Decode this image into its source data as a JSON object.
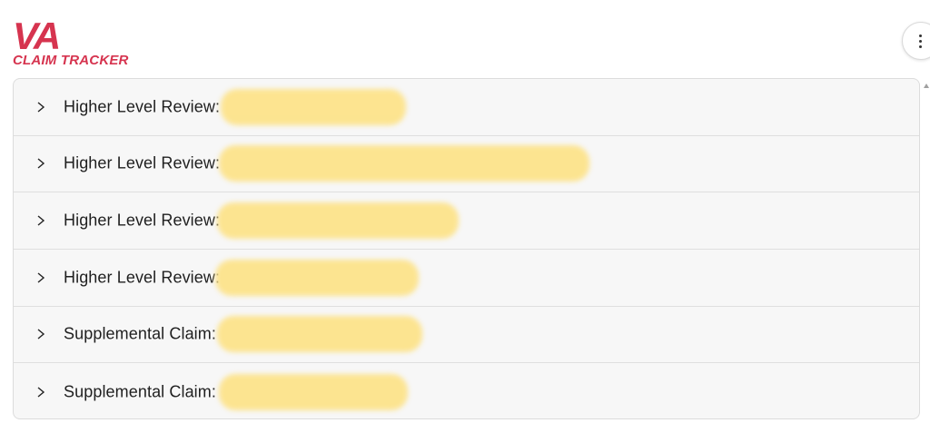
{
  "logo": {
    "line1": "VA",
    "line2": "CLAIM TRACKER",
    "color": "#d6344f"
  },
  "menu": {
    "icon": "more-vertical-icon"
  },
  "claims": [
    {
      "label": "Higher Level Review:",
      "expand_icon": "chevron-right-icon",
      "redacted": true
    },
    {
      "label": "Higher Level Review:",
      "expand_icon": "chevron-right-icon",
      "redacted": true
    },
    {
      "label": "Higher Level Review:",
      "expand_icon": "chevron-right-icon",
      "redacted": true
    },
    {
      "label": "Higher Level Review:",
      "expand_icon": "chevron-right-icon",
      "redacted": true
    },
    {
      "label": "Supplemental Claim:",
      "expand_icon": "chevron-right-icon",
      "redacted": true
    },
    {
      "label": "Supplemental Claim:",
      "expand_icon": "chevron-right-icon",
      "redacted": true
    }
  ],
  "colors": {
    "redaction": "#fde38b",
    "row_background": "#f7f7f7",
    "border": "#dcdcdc"
  }
}
